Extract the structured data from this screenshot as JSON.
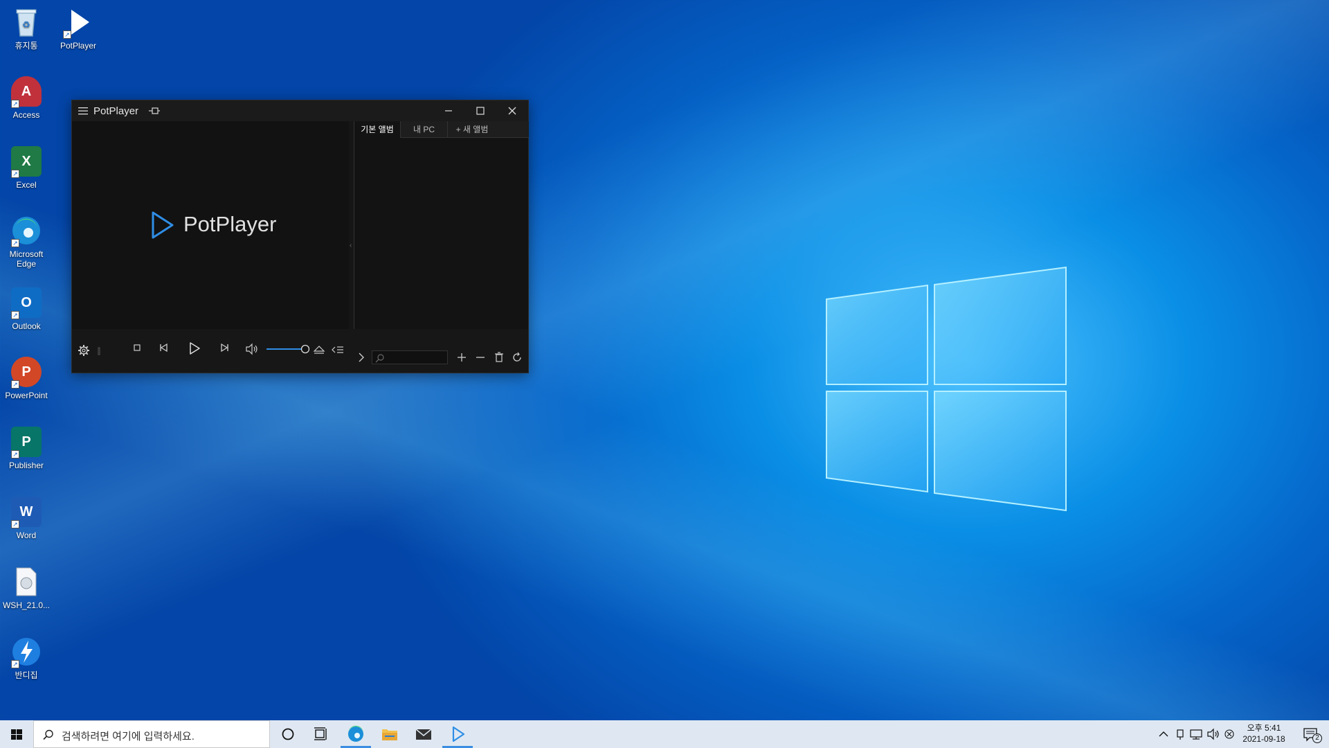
{
  "desktop": {
    "icons": [
      {
        "label": "휴지통"
      },
      {
        "label": "PotPlayer"
      },
      {
        "label": "Access"
      },
      {
        "label": "Excel"
      },
      {
        "label": "Microsoft Edge"
      },
      {
        "label": "Outlook"
      },
      {
        "label": "PowerPoint"
      },
      {
        "label": "Publisher"
      },
      {
        "label": "Word"
      },
      {
        "label": "WSH_21.0..."
      },
      {
        "label": "반디집"
      }
    ]
  },
  "potplayer": {
    "title": "PotPlayer",
    "logo_text": "PotPlayer",
    "tabs": [
      {
        "label": "기본 앨범",
        "active": true
      },
      {
        "label": "내 PC",
        "active": false
      },
      {
        "label": "+ 새 앨범",
        "active": false
      }
    ],
    "volume_level": 1.0,
    "icons": {
      "menu": "hamburger-icon",
      "pin": "pin-icon",
      "minimize": "minimize-icon",
      "maximize": "maximize-icon",
      "close": "close-icon",
      "settings": "gear-icon",
      "stop": "stop-icon",
      "prev": "skip-previous-icon",
      "play": "play-icon",
      "next": "skip-next-icon",
      "volume": "speaker-icon",
      "eject": "eject-icon",
      "playlist": "playlist-icon",
      "expand": "chevron-right-icon",
      "search": "search-icon",
      "add": "plus-icon",
      "remove": "minus-icon",
      "delete": "trash-icon",
      "refresh": "refresh-icon"
    }
  },
  "taskbar": {
    "search_placeholder": "검색하려면 여기에 입력하세요.",
    "clock_time": "오후 5:41",
    "clock_date": "2021-09-18",
    "notification_count": "2"
  },
  "colors": {
    "accent": "#3a8de0",
    "pot_logo_blue": "#2f8ee6"
  }
}
